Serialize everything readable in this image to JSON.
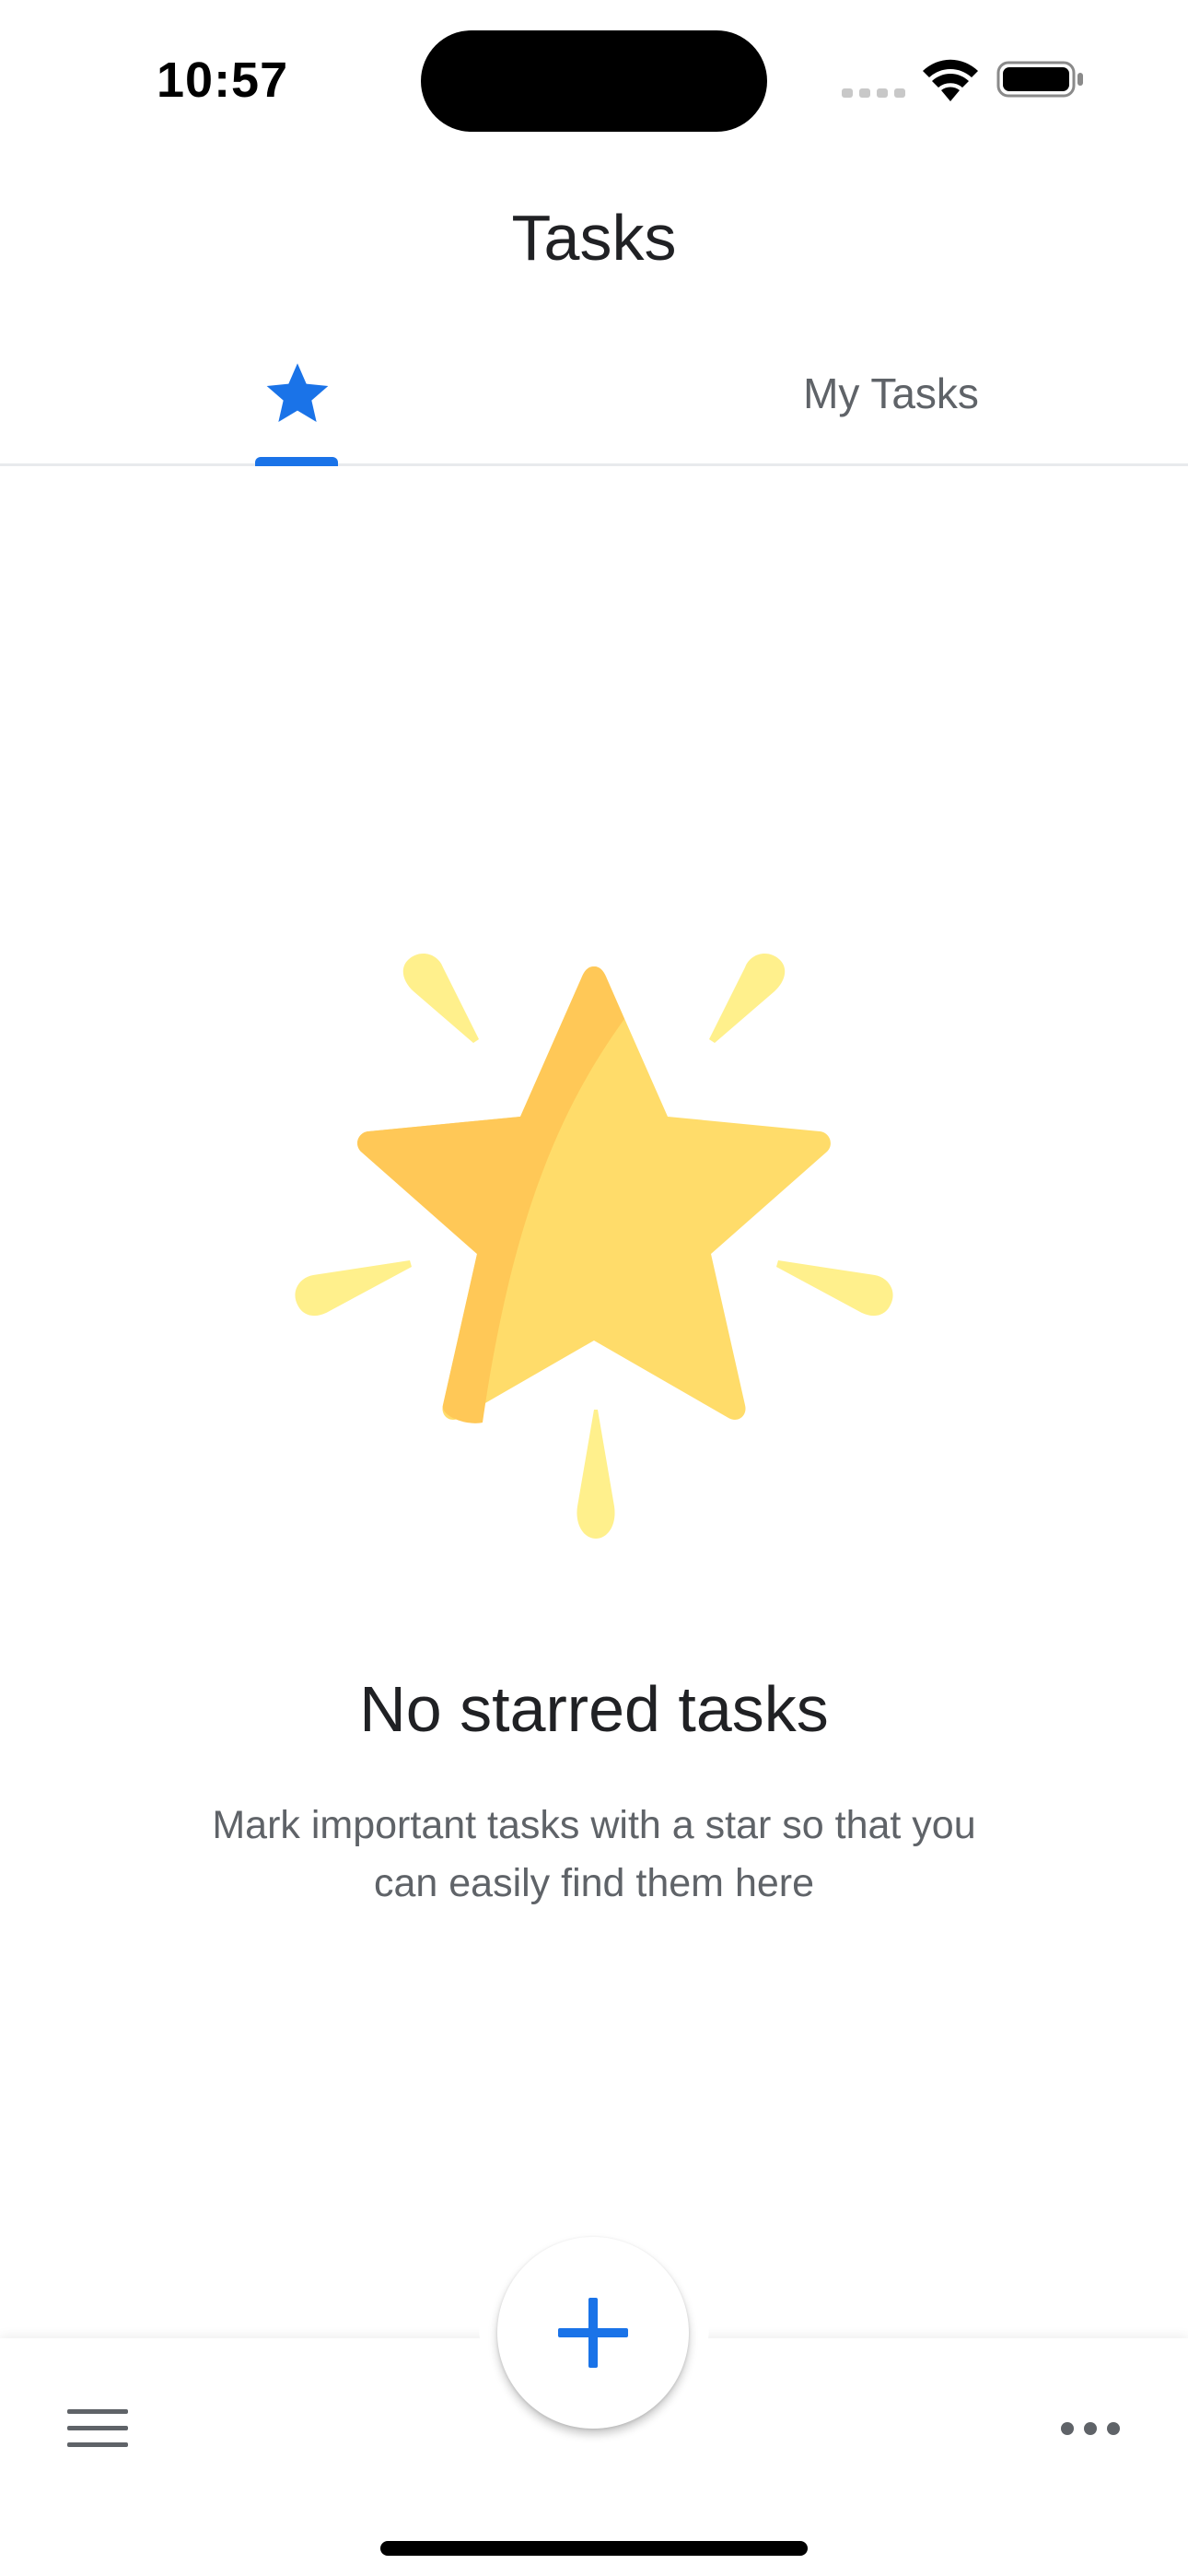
{
  "status_bar": {
    "time": "10:57"
  },
  "header": {
    "title": "Tasks"
  },
  "tabs": [
    {
      "name": "starred",
      "icon": "star-icon",
      "label": "",
      "selected": true
    },
    {
      "name": "my-tasks",
      "label": "My Tasks",
      "selected": false
    }
  ],
  "empty_state": {
    "illustration": "starred-illustration",
    "title": "No starred tasks",
    "description": "Mark important tasks with a star so that you can easily find them here"
  },
  "bottom_bar": {
    "menu_icon": "menu-icon",
    "add_icon": "plus-icon",
    "more_icon": "more-horizontal-icon"
  },
  "colors": {
    "accent": "#1a73e8",
    "star_dark": "#ffc857",
    "star_light": "#ffdc6a",
    "rays": "#fff08c",
    "text_primary": "#202124",
    "text_secondary": "#5f6368"
  }
}
